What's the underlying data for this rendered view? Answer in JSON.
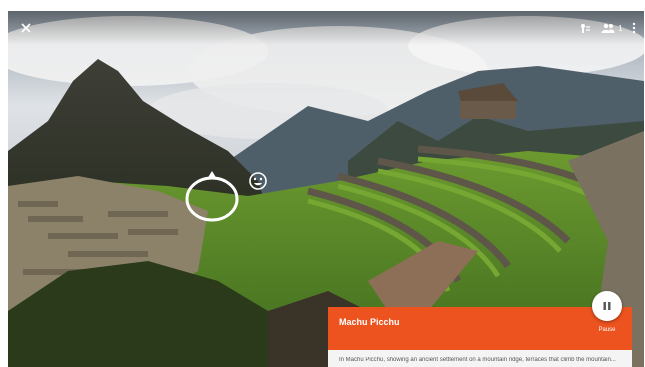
{
  "toolbar": {
    "close_icon": "close-icon",
    "tour_icon": "tour-icon",
    "people_icon": "people-icon",
    "people_count": "1",
    "more_icon": "more-vert-icon"
  },
  "viewer": {
    "navigation_icon": "navigation-ring-icon",
    "reaction_icon": "smiley-icon"
  },
  "info_card": {
    "title": "Machu Picchu",
    "body": "In Machu Picchu, showing an ancient settlement on a mountain ridge, terraces that climb the mountain..."
  },
  "playback": {
    "pause_icon": "pause-icon",
    "pause_label": "Pause"
  },
  "colors": {
    "card_accent": "#ec531f"
  }
}
